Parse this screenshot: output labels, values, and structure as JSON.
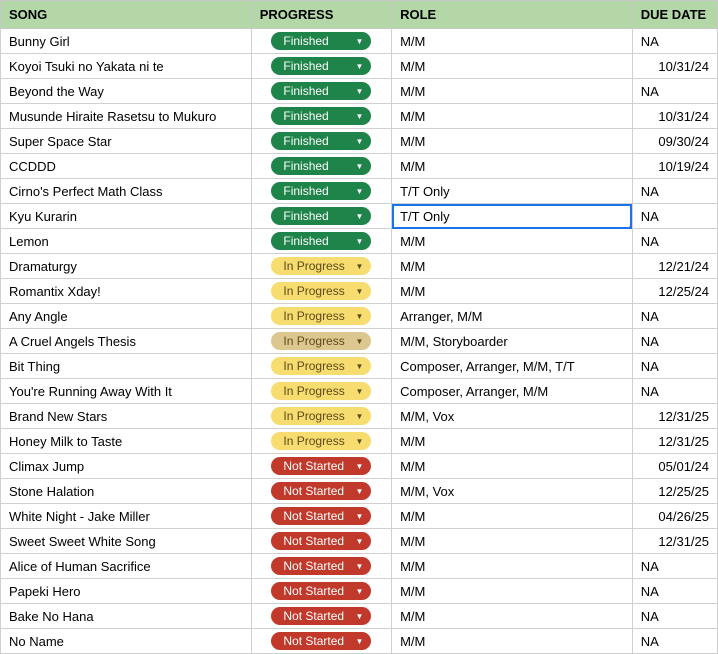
{
  "headers": {
    "song": "SONG",
    "progress": "PROGRESS",
    "role": "ROLE",
    "due": "DUE DATE"
  },
  "status_labels": {
    "finished": "Finished",
    "inprogress": "In Progress",
    "notstarted": "Not Started"
  },
  "rows": [
    {
      "song": "Bunny Girl",
      "progress": "finished",
      "role": "M/M",
      "due": "NA",
      "due_align": "left"
    },
    {
      "song": "Koyoi Tsuki no Yakata ni te",
      "progress": "finished",
      "role": "M/M",
      "due": "10/31/24",
      "due_align": "right"
    },
    {
      "song": "Beyond the Way",
      "progress": "finished",
      "role": "M/M",
      "due": "NA",
      "due_align": "left"
    },
    {
      "song": "Musunde Hiraite Rasetsu to Mukuro",
      "progress": "finished",
      "role": "M/M",
      "due": "10/31/24",
      "due_align": "right"
    },
    {
      "song": "Super Space Star",
      "progress": "finished",
      "role": "M/M",
      "due": "09/30/24",
      "due_align": "right"
    },
    {
      "song": "CCDDD",
      "progress": "finished",
      "role": "M/M",
      "due": "10/19/24",
      "due_align": "right"
    },
    {
      "song": "Cirno's Perfect Math Class",
      "progress": "finished",
      "role": "T/T Only",
      "due": "NA",
      "due_align": "left"
    },
    {
      "song": "Kyu Kurarin",
      "progress": "finished",
      "role": "T/T Only",
      "due": "NA",
      "due_align": "left",
      "selected": true
    },
    {
      "song": "Lemon",
      "progress": "finished",
      "role": "M/M",
      "due": "NA",
      "due_align": "left"
    },
    {
      "song": "Dramaturgy",
      "progress": "inprogress",
      "role": "M/M",
      "due": "12/21/24",
      "due_align": "right"
    },
    {
      "song": "Romantix Xday!",
      "progress": "inprogress",
      "role": "M/M",
      "due": "12/25/24",
      "due_align": "right"
    },
    {
      "song": "Any Angle",
      "progress": "inprogress",
      "role": "Arranger, M/M",
      "due": "NA",
      "due_align": "left"
    },
    {
      "song": "A Cruel Angels Thesis",
      "progress": "inprogress",
      "progress_sel": true,
      "role": "M/M, Storyboarder",
      "due": "NA",
      "due_align": "left"
    },
    {
      "song": "Bit Thing",
      "progress": "inprogress",
      "role": "Composer, Arranger, M/M, T/T",
      "due": "NA",
      "due_align": "left"
    },
    {
      "song": "You're Running Away With It",
      "progress": "inprogress",
      "role": "Composer, Arranger, M/M",
      "due": "NA",
      "due_align": "left"
    },
    {
      "song": "Brand New Stars",
      "progress": "inprogress",
      "role": "M/M, Vox",
      "due": "12/31/25",
      "due_align": "right"
    },
    {
      "song": "Honey Milk to Taste",
      "progress": "inprogress",
      "role": "M/M",
      "due": "12/31/25",
      "due_align": "right"
    },
    {
      "song": "Climax Jump",
      "progress": "notstarted",
      "role": "M/M",
      "due": "05/01/24",
      "due_align": "right"
    },
    {
      "song": "Stone Halation",
      "progress": "notstarted",
      "role": "M/M, Vox",
      "due": "12/25/25",
      "due_align": "right"
    },
    {
      "song": "White Night - Jake Miller",
      "progress": "notstarted",
      "role": "M/M",
      "due": "04/26/25",
      "due_align": "right"
    },
    {
      "song": "Sweet Sweet White Song",
      "progress": "notstarted",
      "role": "M/M",
      "due": "12/31/25",
      "due_align": "right"
    },
    {
      "song": "Alice of Human Sacrifice",
      "progress": "notstarted",
      "role": "M/M",
      "due": "NA",
      "due_align": "left"
    },
    {
      "song": "Papeki Hero",
      "progress": "notstarted",
      "role": "M/M",
      "due": "NA",
      "due_align": "left"
    },
    {
      "song": "Bake No Hana",
      "progress": "notstarted",
      "role": "M/M",
      "due": "NA",
      "due_align": "left"
    },
    {
      "song": "No Name",
      "progress": "notstarted",
      "role": "M/M",
      "due": "NA",
      "due_align": "left"
    }
  ]
}
